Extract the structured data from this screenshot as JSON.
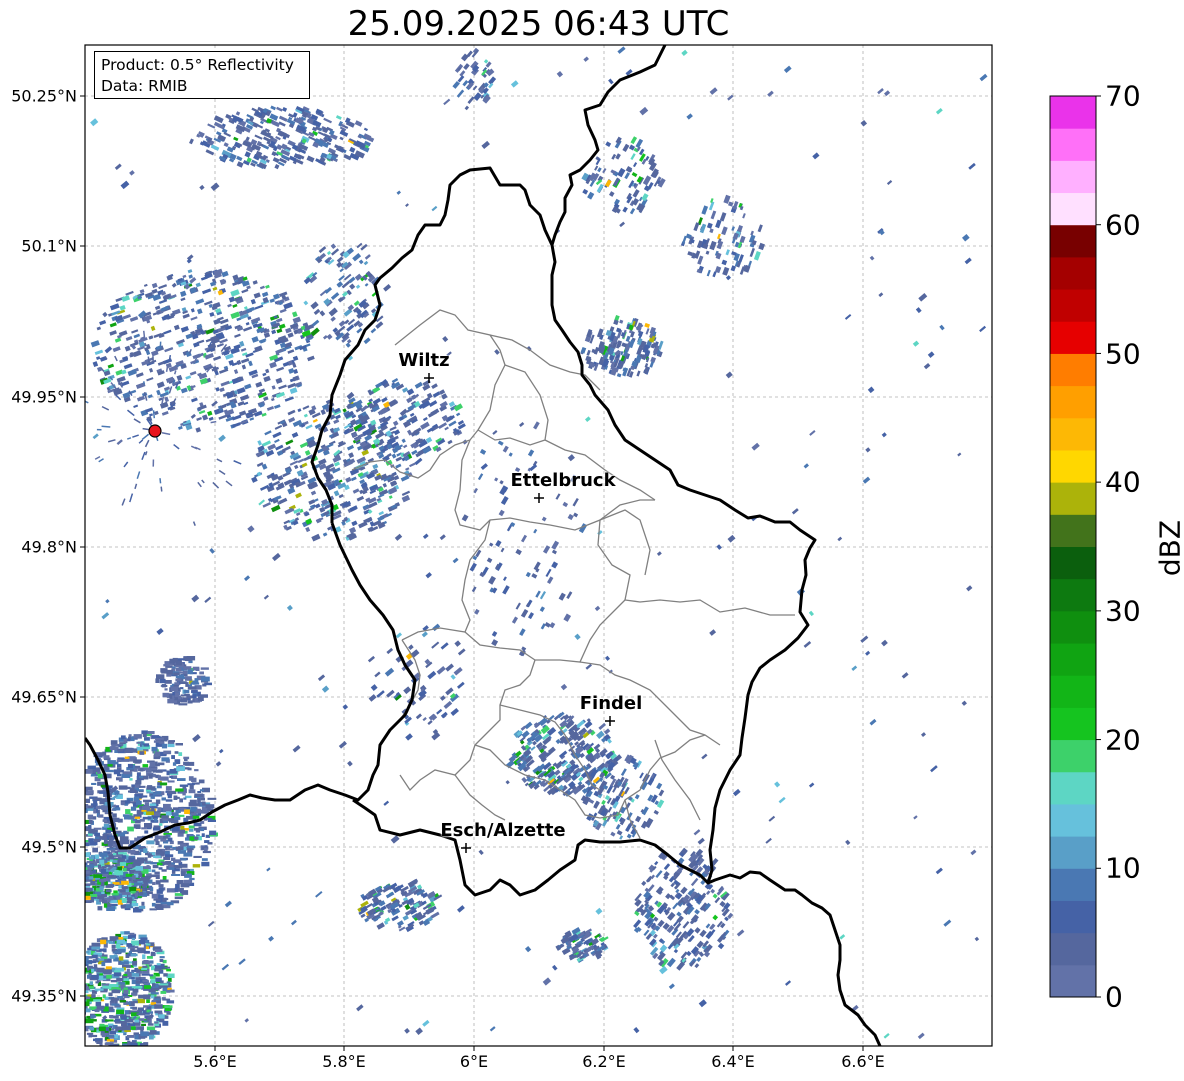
{
  "title": "25.09.2025 06:43 UTC",
  "info": {
    "product": "Product: 0.5° Reflectivity",
    "data": "Data: RMIB"
  },
  "axes": {
    "y_ticks": [
      "50.25°N",
      "50.1°N",
      "49.95°N",
      "49.8°N",
      "49.65°N",
      "49.5°N",
      "49.35°N"
    ],
    "x_ticks": [
      "5.6°E",
      "5.8°E",
      "6°E",
      "6.2°E",
      "6.4°E",
      "6.6°E"
    ]
  },
  "cities": [
    {
      "name": "Wiltz"
    },
    {
      "name": "Ettelbruck"
    },
    {
      "name": "Findel"
    },
    {
      "name": "Esch/Alzette"
    }
  ],
  "colorbar": {
    "title": "dBZ",
    "ticks": [
      "0",
      "10",
      "20",
      "30",
      "40",
      "50",
      "60",
      "70"
    ],
    "colors": [
      "#6272a8",
      "#55679e",
      "#4562a6",
      "#4a78b3",
      "#599fc8",
      "#66c1dc",
      "#5dd6c4",
      "#3dd16a",
      "#15c41f",
      "#12b517",
      "#10a412",
      "#0f8f0f",
      "#0d7a10",
      "#0b5f0d",
      "#42731b",
      "#acb30a",
      "#ffd700",
      "#fdb805",
      "#ff9f00",
      "#ff7d00",
      "#e60000",
      "#c00000",
      "#a40000",
      "#780000",
      "#ffe0ff",
      "#ffb0ff",
      "#ff70f8",
      "#ea33ea"
    ]
  },
  "radar_site_color": "#e8141e"
}
